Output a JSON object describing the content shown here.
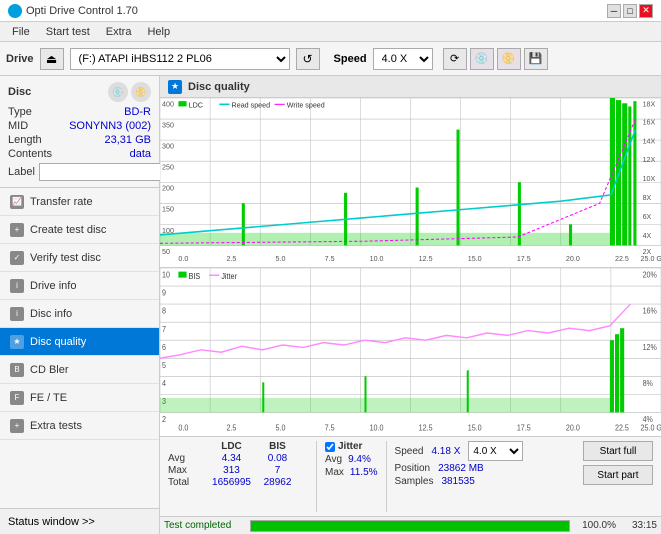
{
  "titlebar": {
    "title": "Opti Drive Control 1.70",
    "icon": "●",
    "min": "─",
    "max": "□",
    "close": "✕"
  },
  "menu": {
    "items": [
      "File",
      "Start test",
      "Extra",
      "Help"
    ]
  },
  "drivebar": {
    "label": "Drive",
    "drive_value": "(F:) ATAPI iHBS112  2 PL06",
    "speed_label": "Speed",
    "speed_value": "4.0 X"
  },
  "disc": {
    "title": "Disc",
    "type_label": "Type",
    "type_val": "BD-R",
    "mid_label": "MID",
    "mid_val": "SONYNN3 (002)",
    "length_label": "Length",
    "length_val": "23,31 GB",
    "contents_label": "Contents",
    "contents_val": "data",
    "label_label": "Label",
    "label_placeholder": ""
  },
  "nav": {
    "items": [
      {
        "id": "transfer-rate",
        "label": "Transfer rate",
        "active": false
      },
      {
        "id": "create-test-disc",
        "label": "Create test disc",
        "active": false
      },
      {
        "id": "verify-test-disc",
        "label": "Verify test disc",
        "active": false
      },
      {
        "id": "drive-info",
        "label": "Drive info",
        "active": false
      },
      {
        "id": "disc-info",
        "label": "Disc info",
        "active": false
      },
      {
        "id": "disc-quality",
        "label": "Disc quality",
        "active": true
      },
      {
        "id": "cd-bler",
        "label": "CD Bler",
        "active": false
      },
      {
        "id": "fe-te",
        "label": "FE / TE",
        "active": false
      },
      {
        "id": "extra-tests",
        "label": "Extra tests",
        "active": false
      }
    ]
  },
  "status_window": {
    "label": "Status window >>",
    "status_text": "Test completed"
  },
  "disc_quality": {
    "title": "Disc quality",
    "legend_top": {
      "ldc": "LDC",
      "read_speed": "Read speed",
      "write_speed": "Write speed"
    },
    "legend_bottom": {
      "bis": "BIS",
      "jitter": "Jitter"
    }
  },
  "stats": {
    "headers": [
      "",
      "LDC",
      "BIS"
    ],
    "avg_label": "Avg",
    "avg_ldc": "4.34",
    "avg_bis": "0.08",
    "max_label": "Max",
    "max_ldc": "313",
    "max_bis": "7",
    "total_label": "Total",
    "total_ldc": "1656995",
    "total_bis": "28962",
    "jitter_label": "Jitter",
    "jitter_avg": "9.4%",
    "jitter_max": "11.5%",
    "speed_label": "Speed",
    "speed_val": "4.18 X",
    "position_label": "Position",
    "position_val": "23862 MB",
    "samples_label": "Samples",
    "samples_val": "381535",
    "speed_select": "4.0 X",
    "start_full": "Start full",
    "start_part": "Start part"
  },
  "progress": {
    "percent": "100.0%",
    "fill_width": 100,
    "time": "33:15",
    "status": "Test completed"
  },
  "colors": {
    "ldc_line": "#00aa00",
    "read_speed": "#00cccc",
    "write_speed": "#ff00ff",
    "bis_line": "#00aa00",
    "jitter_line": "#ff88ff",
    "grid": "#cccccc",
    "accent": "#0078d7"
  }
}
